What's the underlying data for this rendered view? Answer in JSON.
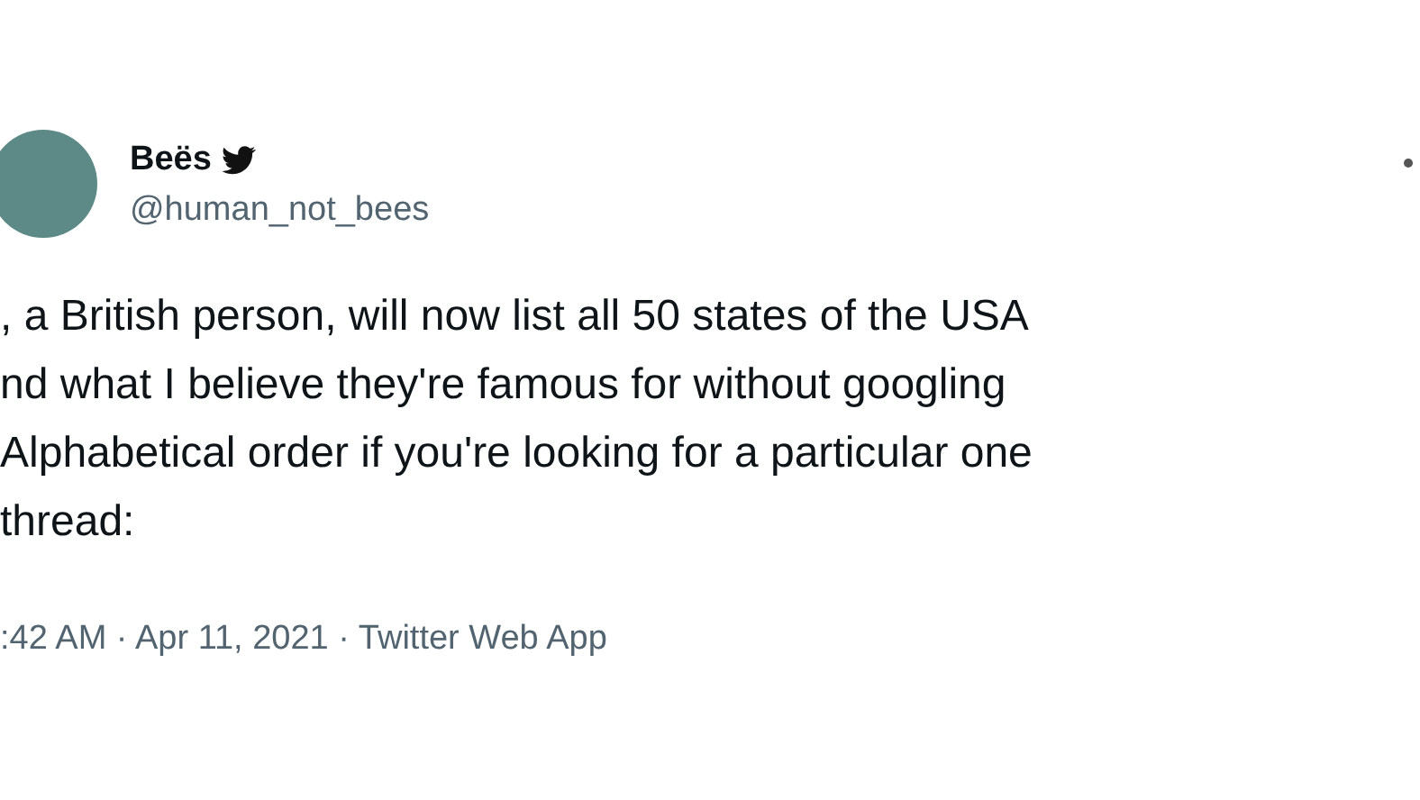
{
  "author": {
    "name": "Beës",
    "handle": "@human_not_bees"
  },
  "tweet_lines": [
    ", a British person, will now list all 50 states of the USA",
    "nd what I believe they're famous for without googling",
    "Alphabetical order if you're looking for a particular one",
    "thread:"
  ],
  "meta": ":42 AM · Apr 11, 2021 · Twitter Web App"
}
